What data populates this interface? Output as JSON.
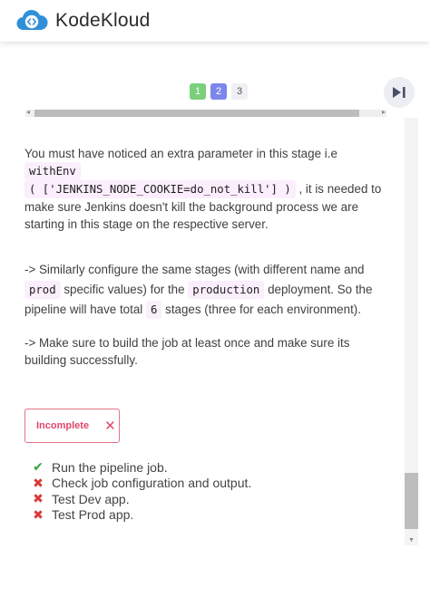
{
  "header": {
    "brand": "KodeKloud"
  },
  "pager": {
    "pages": [
      "1",
      "2",
      "3"
    ]
  },
  "content": {
    "p1_before": "You must have noticed an extra parameter in this stage i.e ",
    "p1_code1": "withEnv",
    "p1_code2": "( ['JENKINS_NODE_COOKIE=do_not_kill'] )",
    "p1_after": ", it is needed to make sure Jenkins doesn't kill the background process we are starting in this stage on the respective server.",
    "p2_before": "-> Similarly configure the same stages (with different name and ",
    "p2_code1": "prod",
    "p2_mid1": " specific values) for the ",
    "p2_code2": "production",
    "p2_mid2": " deployment. So the pipeline will have total ",
    "p2_code3": "6",
    "p2_after": " stages (three for each environment).",
    "p3": "-> Make sure to build the job at least once and make sure its building successfully."
  },
  "status": {
    "label": "Incomplete"
  },
  "checklist": [
    {
      "text": "Run the pipeline job.",
      "ok": true
    },
    {
      "text": "Check job configuration and output.",
      "ok": false
    },
    {
      "text": "Test Dev app.",
      "ok": false
    },
    {
      "text": "Test Prod app.",
      "ok": false
    }
  ],
  "colors": {
    "accent": "#7d86ea",
    "success": "#33a443",
    "error": "#e0466a",
    "code_bg": "#fbeefd"
  }
}
